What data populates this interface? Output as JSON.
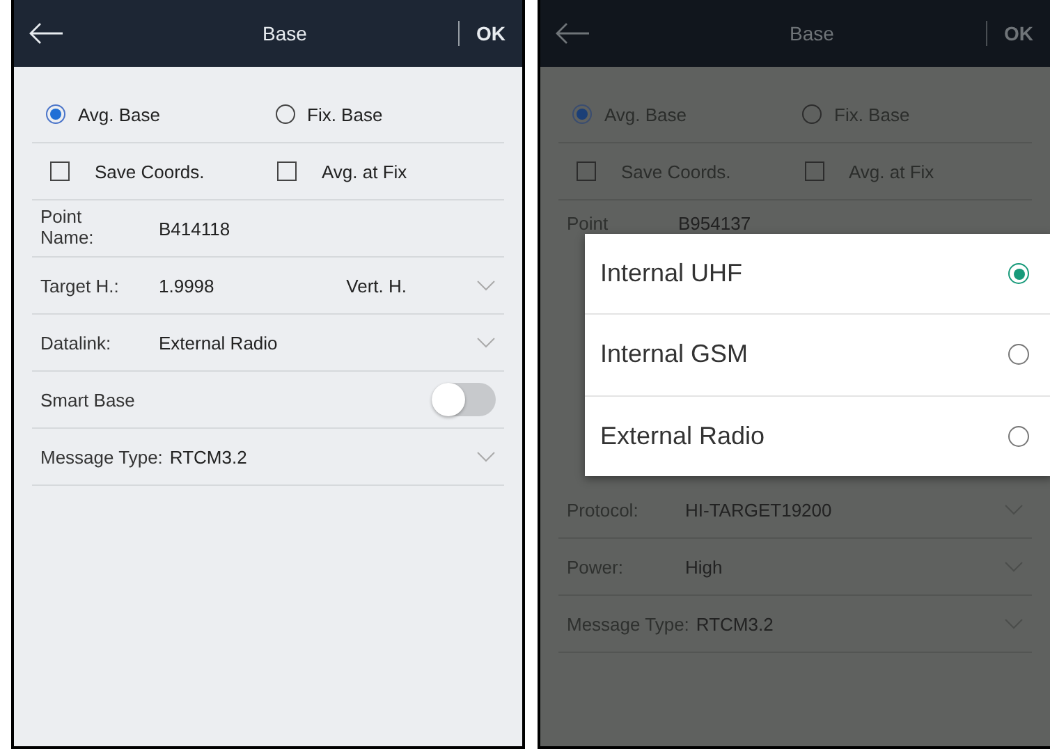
{
  "screens": [
    {
      "dimmed": false,
      "header": {
        "title": "Base",
        "action": "OK"
      },
      "modes": [
        {
          "label": "Avg. Base",
          "selected": true
        },
        {
          "label": "Fix. Base",
          "selected": false
        }
      ],
      "options": [
        {
          "label": "Save Coords.",
          "checked": false
        },
        {
          "label": "Avg. at Fix",
          "checked": false
        }
      ],
      "fields_top": [
        {
          "kind": "text",
          "label": "Point Name:",
          "value": "B414118"
        }
      ],
      "fields": [
        {
          "kind": "dropdown",
          "label": "Target H.:",
          "value": "1.9998",
          "unit": "Vert. H."
        },
        {
          "kind": "dropdown",
          "label": "Datalink:",
          "value": "External Radio"
        },
        {
          "kind": "toggle",
          "label": "Smart Base",
          "on": false
        },
        {
          "kind": "dropdown",
          "label": "Message Type:",
          "value": "RTCM3.2"
        }
      ]
    },
    {
      "dimmed": true,
      "header": {
        "title": "Base",
        "action": "OK"
      },
      "modes": [
        {
          "label": "Avg. Base",
          "selected": true
        },
        {
          "label": "Fix. Base",
          "selected": false
        }
      ],
      "options": [
        {
          "label": "Save Coords.",
          "checked": false
        },
        {
          "label": "Avg. at Fix",
          "checked": false
        }
      ],
      "fields_top": [
        {
          "kind": "text",
          "label": "Point",
          "value": "B954137"
        }
      ],
      "dialog": {
        "options": [
          {
            "label": "Internal UHF",
            "selected": true
          },
          {
            "label": "Internal GSM",
            "selected": false
          },
          {
            "label": "External Radio",
            "selected": false
          }
        ]
      },
      "fields": [
        {
          "kind": "dropdown",
          "label": "Protocol:",
          "value": "HI-TARGET19200"
        },
        {
          "kind": "dropdown",
          "label": "Power:",
          "value": "High"
        },
        {
          "kind": "dropdown",
          "label": "Message Type:",
          "value": "RTCM3.2"
        }
      ]
    }
  ]
}
